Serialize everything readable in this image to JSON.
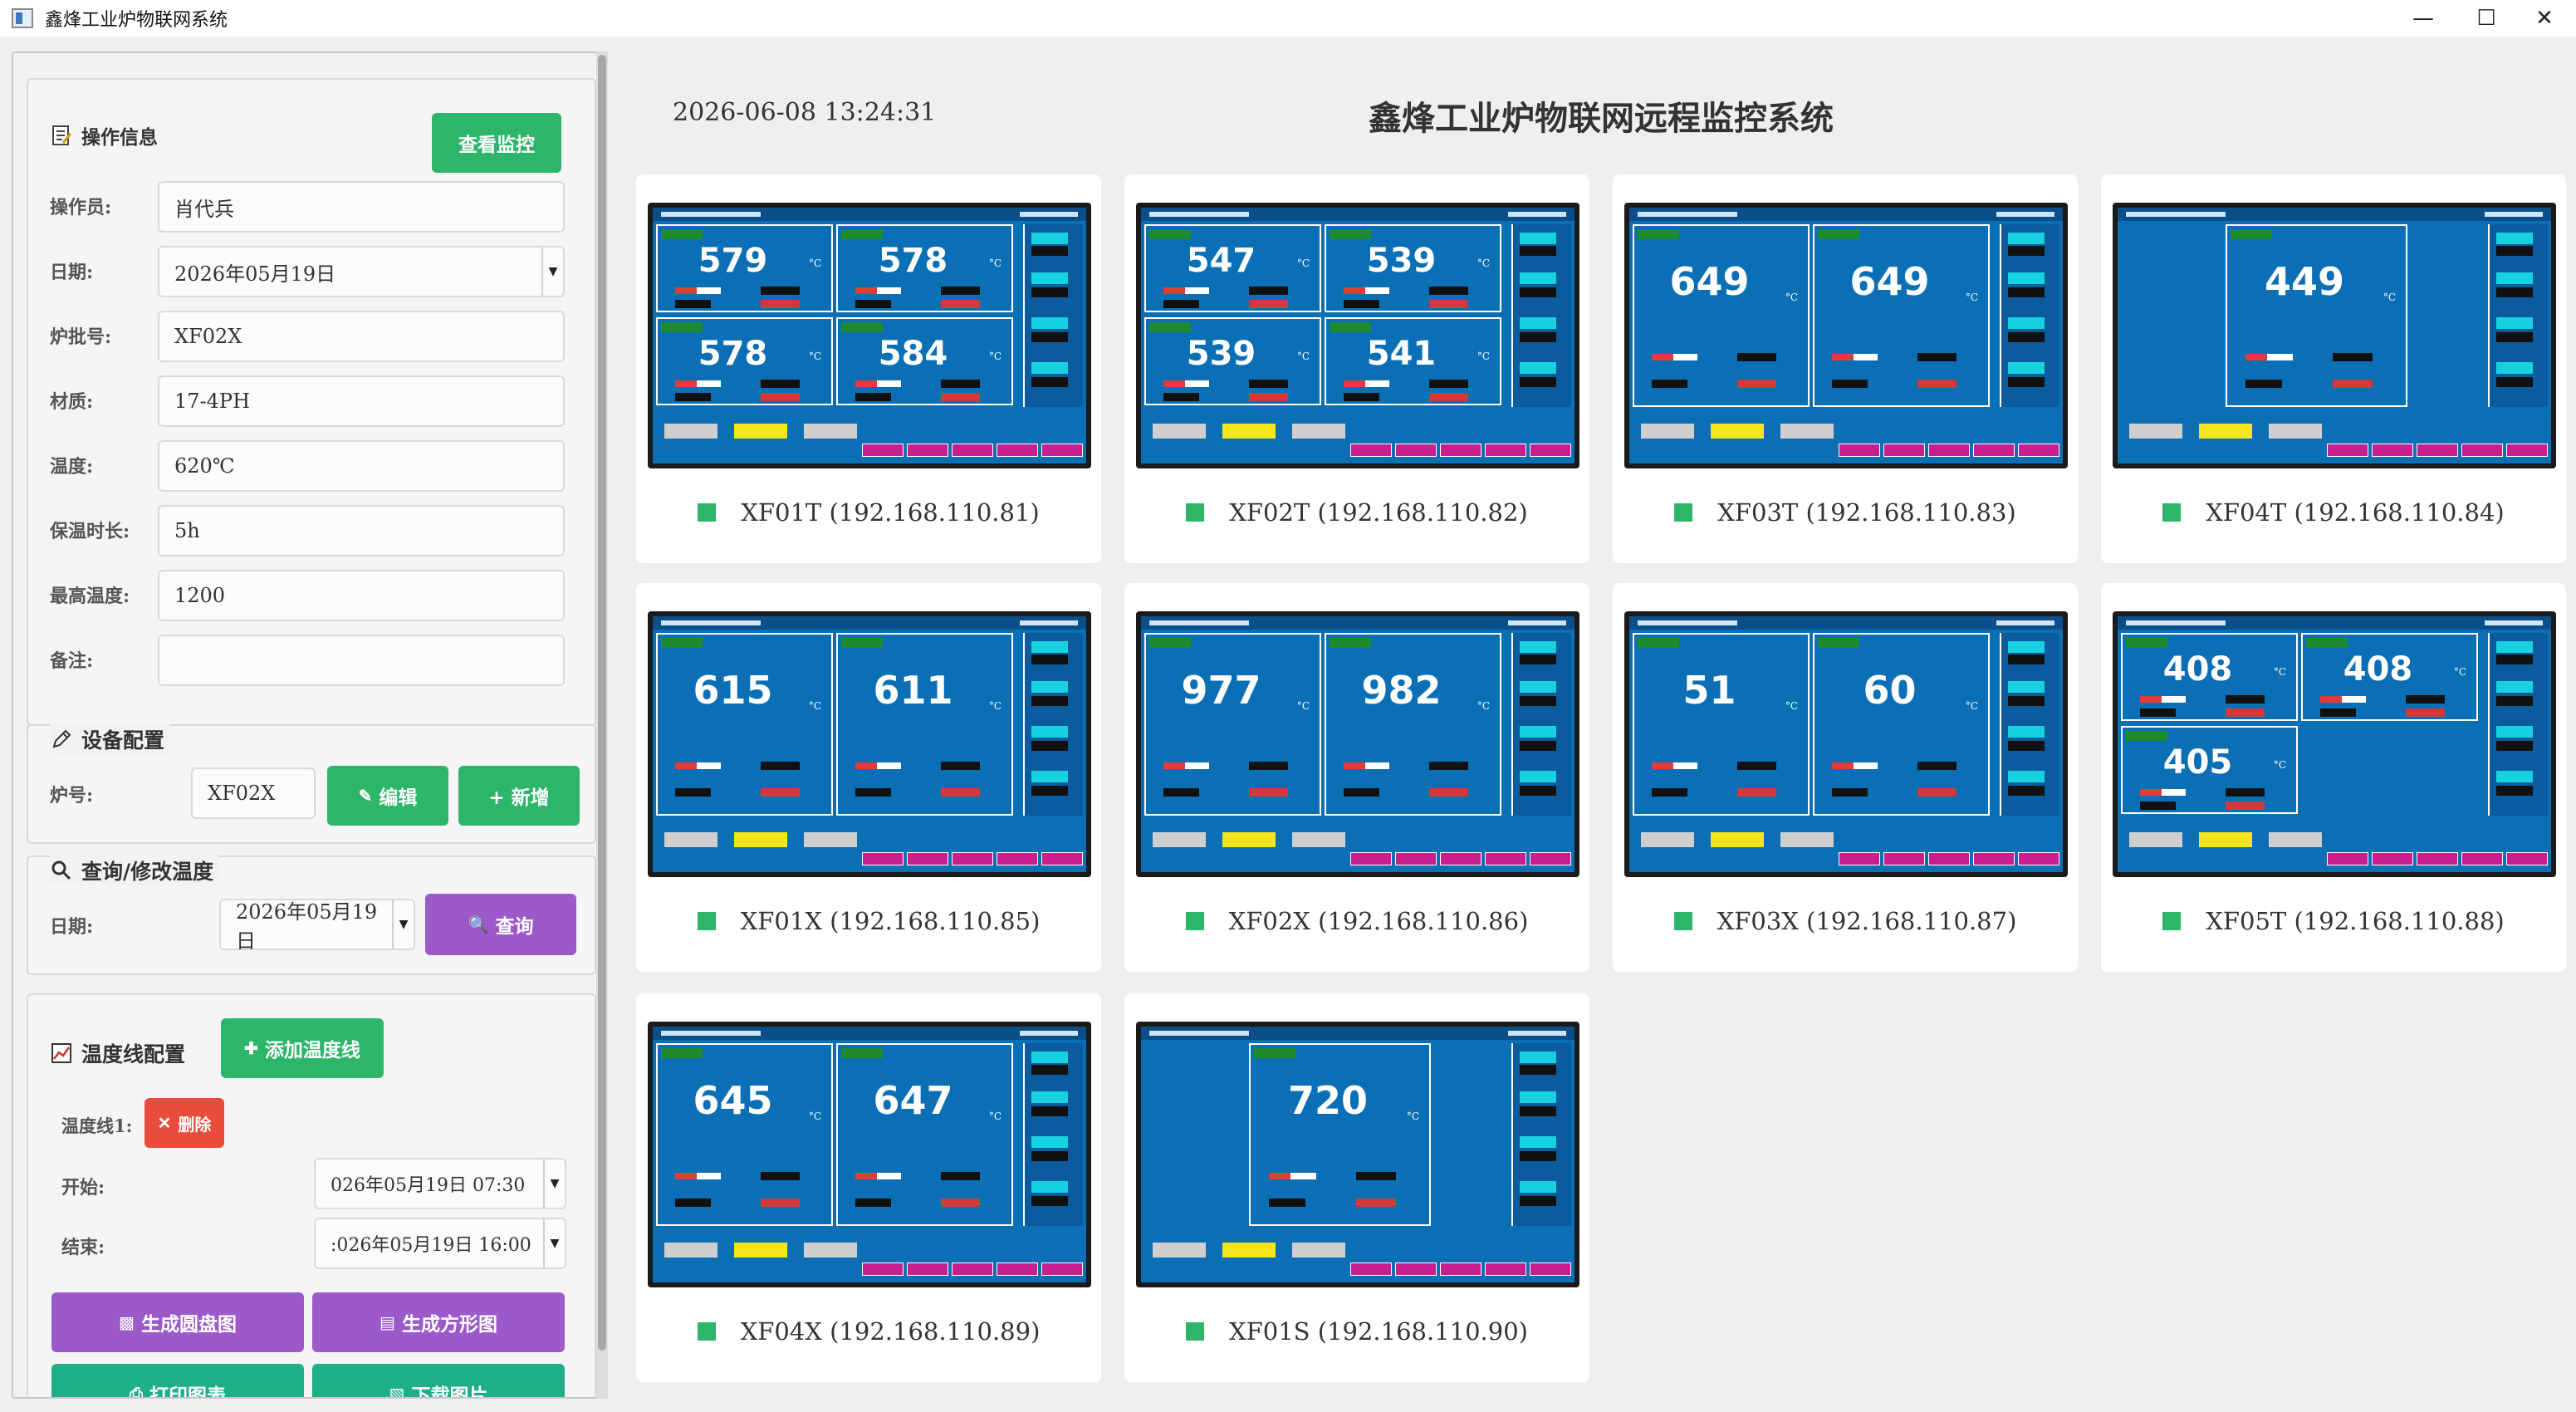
{
  "window": {
    "title": "鑫烽工业炉物联网系统"
  },
  "sidebar": {
    "op": {
      "title": "操作信息",
      "view_button": "查看监控",
      "fields": [
        {
          "label": "操作员:",
          "value": "肖代兵"
        },
        {
          "label": "日期:",
          "value": "2026年05月19日"
        },
        {
          "label": "炉批号:",
          "value": "XF02X"
        },
        {
          "label": "材质:",
          "value": "17-4PH"
        },
        {
          "label": "温度:",
          "value": "620℃"
        },
        {
          "label": "保温时长:",
          "value": "5h"
        },
        {
          "label": "最高温度:",
          "value": "1200"
        },
        {
          "label": "备注:",
          "value": ""
        }
      ]
    },
    "device": {
      "title": "设备配置",
      "furnace_label": "炉号:",
      "furnace_value": "XF02X",
      "edit_button": "编辑",
      "add_button": "+ 新增"
    },
    "query": {
      "title": "查询/修改温度",
      "date_label": "日期:",
      "date_value": "2026年05月19日",
      "query_button": "查询"
    },
    "curve": {
      "title": "温度线配置",
      "add_curve_button": "添加温度线",
      "line_label": "温度线1:",
      "delete_button": "删除",
      "start_label": "开始:",
      "start_value": "026年05月19日 07:30",
      "end_label": "结束:",
      "end_value": ":026年05月19日 16:00",
      "gen_round_button": "生成圆盘图",
      "gen_square_button": "生成方形图",
      "print_button": "打印图表",
      "download_button": "下载图片"
    }
  },
  "main": {
    "timestamp": "2026-06-08 13:24:31",
    "title": "鑫烽工业炉物联网远程监控系统",
    "devices": [
      {
        "label": "XF01T (192.168.110.81)",
        "readings": [
          "579",
          "578",
          "578",
          "584"
        ],
        "layout": "quad"
      },
      {
        "label": "XF02T (192.168.110.82)",
        "readings": [
          "547",
          "539",
          "539",
          "541"
        ],
        "layout": "quad"
      },
      {
        "label": "XF03T (192.168.110.83)",
        "readings": [
          "649",
          "649"
        ],
        "layout": "dual"
      },
      {
        "label": "XF04T (192.168.110.84)",
        "readings": [
          "449"
        ],
        "layout": "single"
      },
      {
        "label": "XF01X (192.168.110.85)",
        "readings": [
          "615",
          "611"
        ],
        "layout": "dual"
      },
      {
        "label": "XF02X (192.168.110.86)",
        "readings": [
          "977",
          "982"
        ],
        "layout": "dual"
      },
      {
        "label": "XF03X (192.168.110.87)",
        "readings": [
          "51",
          "60"
        ],
        "layout": "dual"
      },
      {
        "label": "XF05T (192.168.110.88)",
        "readings": [
          "408",
          "408",
          "405"
        ],
        "layout": "triple"
      },
      {
        "label": "XF04X (192.168.110.89)",
        "readings": [
          "645",
          "647"
        ],
        "layout": "dual"
      },
      {
        "label": "XF01S (192.168.110.90)",
        "readings": [
          "720"
        ],
        "layout": "single"
      }
    ]
  },
  "colors": {
    "accent_green": "#2db56a",
    "accent_purple": "#9b59c9",
    "danger_red": "#e74c3c",
    "screen_blue": "#0b6fb6",
    "status_online": "#2db56a"
  }
}
